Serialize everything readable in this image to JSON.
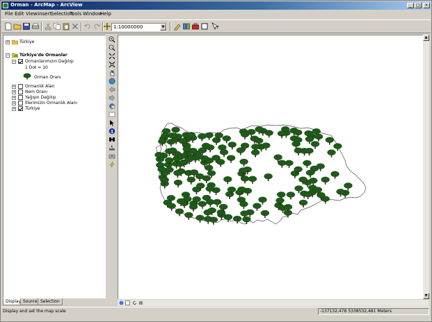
{
  "window": {
    "title": "Orman - ArcMap - ArcView",
    "controls": [
      "_",
      "□",
      "×"
    ]
  },
  "menu": [
    "File",
    "Edit",
    "View",
    "Insert",
    "Selection",
    "Tools",
    "Window",
    "Help"
  ],
  "toolbar": {
    "scale_value": "1:10000000",
    "icons": [
      "new-icon",
      "open-icon",
      "save-icon",
      "print-icon",
      "cut-icon",
      "copy-icon",
      "paste-icon",
      "delete-icon",
      "undo-icon",
      "redo-icon",
      "add-data-icon",
      "editor-icon",
      "catalog-icon",
      "toolbox-icon",
      "layout-icon",
      "help-icon"
    ]
  },
  "toc": {
    "top_layer": "Türkiye",
    "data_frame": "Türkiye'de Ormanlar",
    "active_layer": "Ormanlarımızın Dağılışı",
    "dot_legend": "1 Dot = 10",
    "legend_symbol_label": "Orman Oranı",
    "layers": [
      {
        "name": "Ormanlık Alan",
        "checked": false
      },
      {
        "name": "Nem Oranı",
        "checked": false
      },
      {
        "name": "Yağışın Dağılışı",
        "checked": false
      },
      {
        "name": "İllerimizin Ormanlık Alanı",
        "checked": false
      },
      {
        "name": "Türkiye",
        "checked": true
      }
    ],
    "tabs": [
      "Display",
      "Source",
      "Selection"
    ]
  },
  "tools": [
    "zoom-in-icon",
    "zoom-out-icon",
    "fixed-zoom-in-icon",
    "fixed-zoom-out-icon",
    "pan-icon",
    "full-extent-icon",
    "back-icon",
    "forward-icon",
    "go-to-xy-icon",
    "map-tips-icon",
    "select-icon",
    "identify-icon",
    "find-icon",
    "measure-icon",
    "hyperlink-icon",
    "lightning-icon"
  ],
  "status": {
    "message": "Display and set the map scale",
    "coordinates": "-137132,478  5338532,481 Meters"
  },
  "colors": {
    "title_start": "#0a246a",
    "title_end": "#a6caf0",
    "tree": "#1f5a1a",
    "tree_dark": "#0e3a0c",
    "chrome": "#d4d0c8"
  }
}
